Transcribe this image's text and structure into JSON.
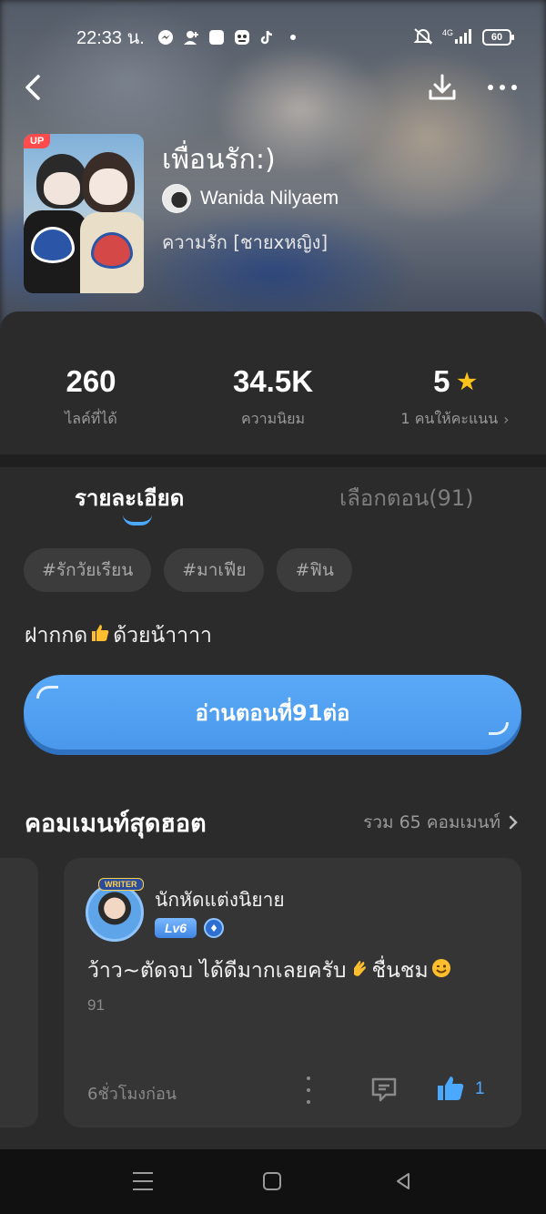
{
  "status_bar": {
    "time": "22:33 น.",
    "network": "4G",
    "battery": "60"
  },
  "story": {
    "title": "เพื่อนรัก:)",
    "author": "Wanida Nilyaem",
    "genre": "ความรัก [ชายxหญิง]",
    "cover_badge": "UP"
  },
  "stats": {
    "likes_value": "260",
    "likes_label": "ไลค์ที่ได้",
    "popularity_value": "34.5K",
    "popularity_label": "ความนิยม",
    "rating_value": "5",
    "rating_label": "1 คนให้คะแนน"
  },
  "tabs": {
    "details": "รายละเอียด",
    "episodes": "เลือกตอน(91)"
  },
  "tags": [
    "#รักวัยเรียน",
    "#มาเฟีย",
    "#ฟิน"
  ],
  "description": {
    "before": "ฝากกด",
    "after": "ด้วยน้าาาา"
  },
  "read_button": "อ่านตอนที่91ต่อ",
  "hot_comments": {
    "title": "คอมเมนท์สุดฮอต",
    "total": "รวม 65 คอมเมนท์"
  },
  "comment": {
    "badge": "WRITER",
    "name": "นักหัดแต่งนิยาย",
    "level": "Lv6",
    "text_1": "ว้าว~ตัดจบ ได้ดีมากเลยครับ",
    "text_2": "ชื่นชม",
    "episode": "91",
    "time": "6ชั่วโมงก่อน",
    "likes": "1"
  },
  "colors": {
    "accent": "#4aa8ff",
    "button": "#4a98ec",
    "star": "#ffc21a",
    "background": "#2b2b2b"
  }
}
